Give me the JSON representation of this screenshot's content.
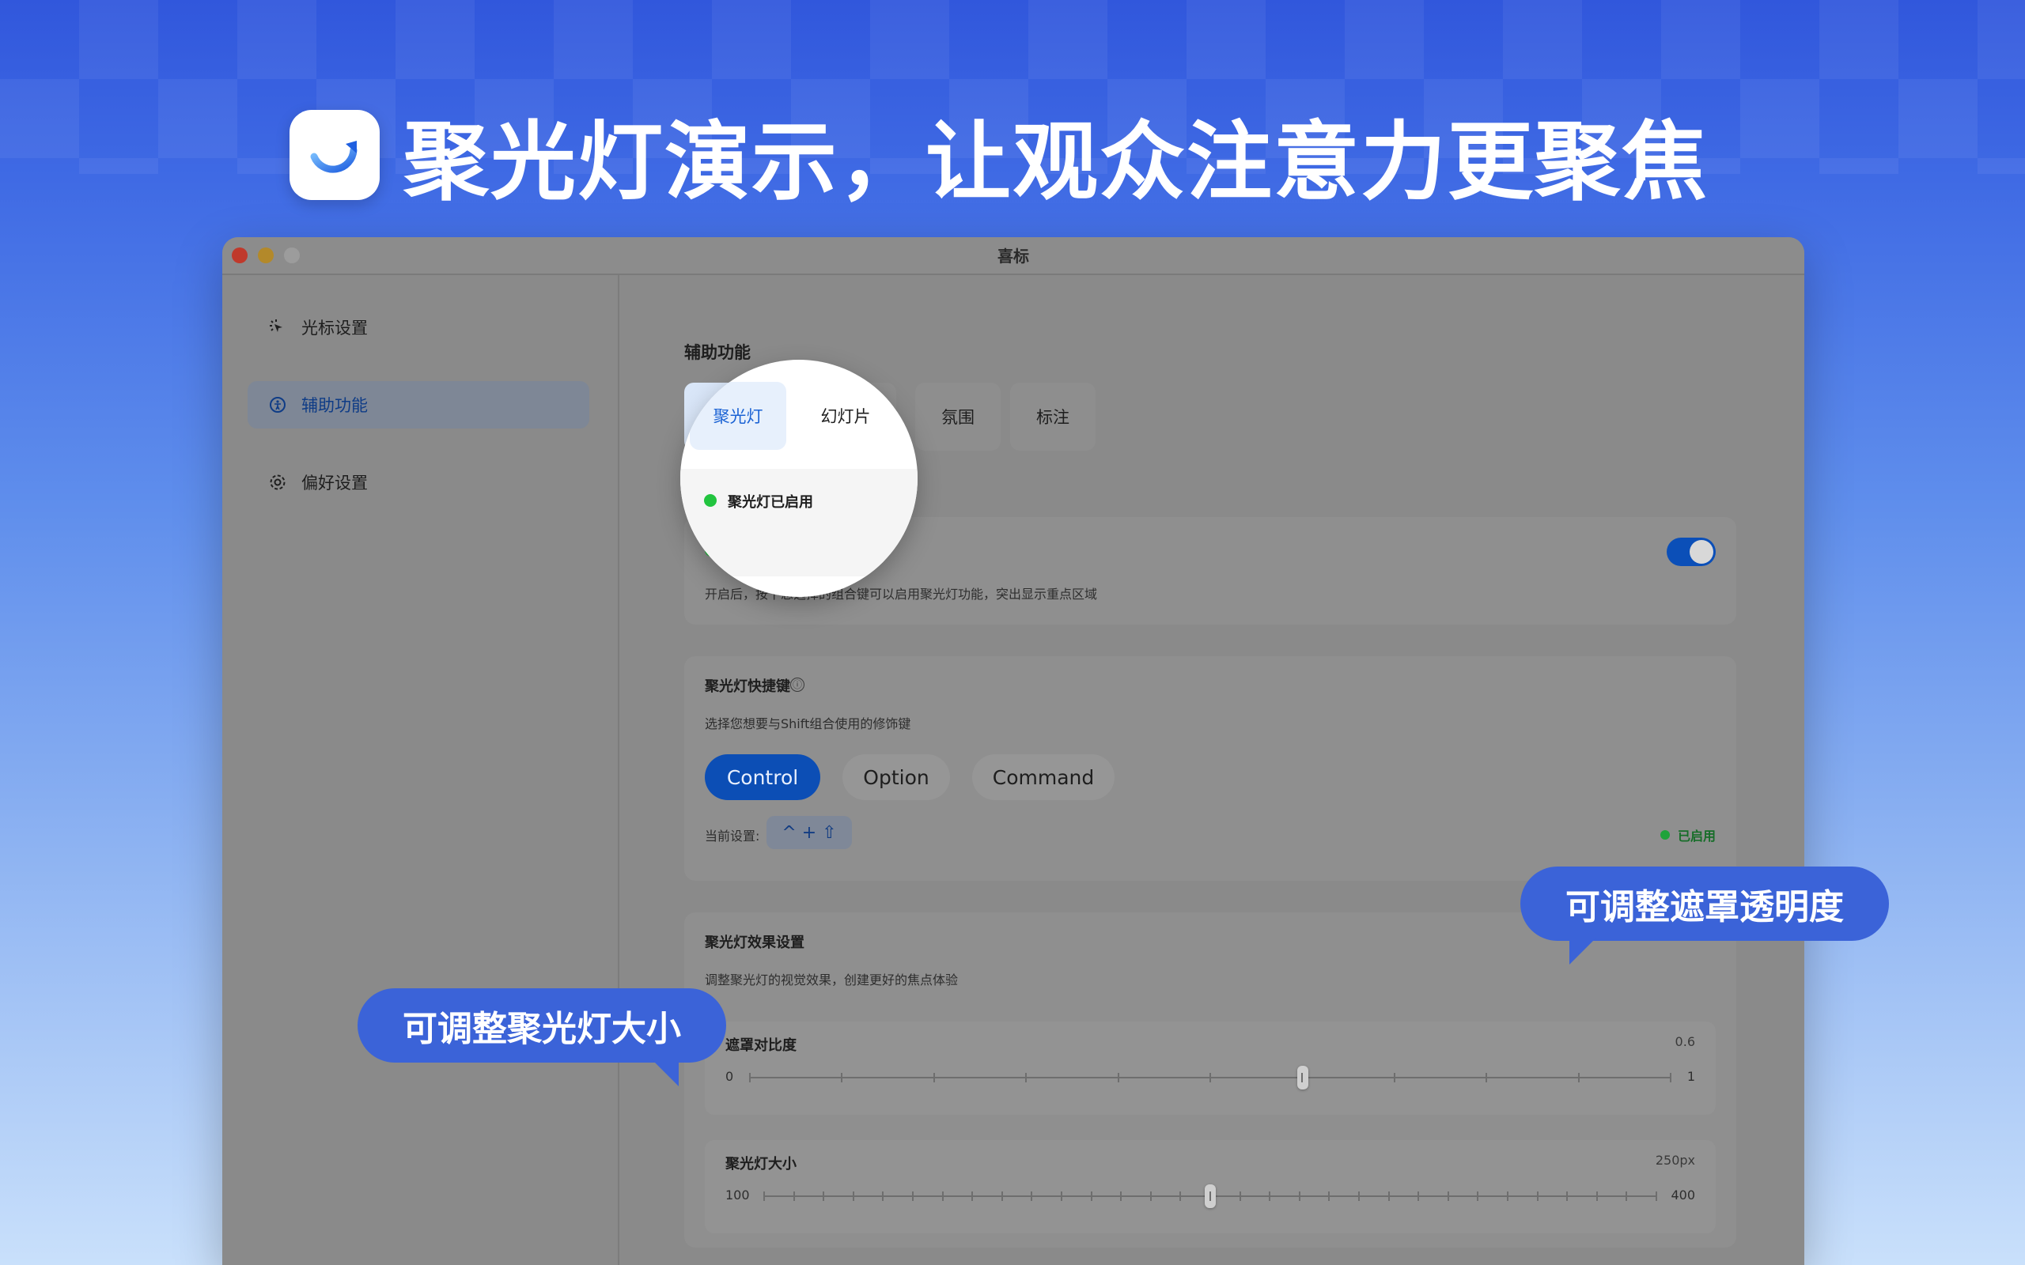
{
  "hero": {
    "title": "聚光灯演示，让观众注意力更聚焦"
  },
  "window": {
    "title": "喜标"
  },
  "sidebar": {
    "items": [
      {
        "label": "光标设置",
        "icon": "cursor-click-icon"
      },
      {
        "label": "辅助功能",
        "icon": "accessibility-icon",
        "active": true
      },
      {
        "label": "偏好设置",
        "icon": "gear-icon"
      }
    ]
  },
  "main": {
    "section_title": "辅助功能",
    "tabs": [
      {
        "label": "聚光灯",
        "active": true
      },
      {
        "label": "幻灯片"
      },
      {
        "label": "氛围"
      },
      {
        "label": "标注"
      }
    ],
    "spotlight_status": {
      "label": "聚光灯已启用",
      "description": "开启后，按下您选择的组合键可以启用聚光灯功能，突出显示重点区域",
      "enabled": true
    },
    "shortcut": {
      "title": "聚光灯快捷键",
      "info_icon": "ⓘ",
      "description": "选择您想要与Shift组合使用的修饰键",
      "options": [
        "Control",
        "Option",
        "Command"
      ],
      "selected": "Control",
      "current_label": "当前设置:",
      "current_keys": "^ + ⇧",
      "enabled_label": "已启用"
    },
    "effect": {
      "title": "聚光灯效果设置",
      "description": "调整聚光灯的视觉效果，创建更好的焦点体验",
      "sliders": [
        {
          "label": "遮罩对比度",
          "value_text": "0.6",
          "min": "0",
          "max": "1",
          "value": 0.6,
          "range": [
            0,
            1
          ]
        },
        {
          "label": "聚光灯大小",
          "value_text": "250px",
          "min": "100",
          "max": "400",
          "value": 250,
          "range": [
            100,
            400
          ]
        }
      ]
    }
  },
  "callouts": {
    "opacity": "可调整遮罩透明度",
    "size": "可调整聚光灯大小"
  },
  "colors": {
    "accent": "#0c4eb5",
    "bubble": "#3b63d8",
    "status_green": "#22b43a"
  }
}
